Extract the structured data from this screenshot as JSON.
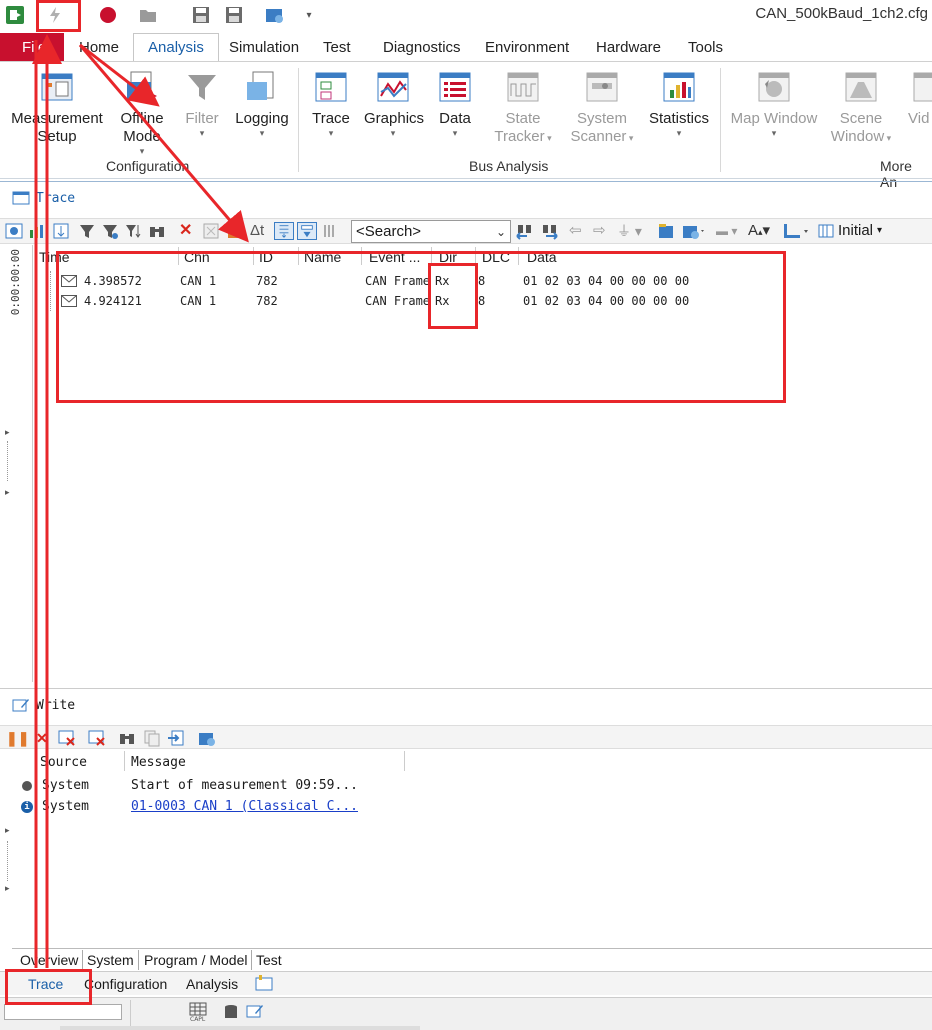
{
  "window": {
    "title": "CAN_500kBaud_1ch2.cfg"
  },
  "menu": {
    "file": "File",
    "tabs": [
      "Home",
      "Analysis",
      "Simulation",
      "Test",
      "Diagnostics",
      "Environment",
      "Hardware",
      "Tools"
    ],
    "active": "Analysis"
  },
  "ribbon": {
    "groups": {
      "configuration": "Configuration",
      "bus_analysis": "Bus Analysis",
      "more": "More An"
    },
    "buttons": {
      "measurement_setup": [
        "Measurement",
        "Setup"
      ],
      "offline_mode": [
        "Offline",
        "Mode"
      ],
      "filter": "Filter",
      "logging": "Logging",
      "trace": "Trace",
      "graphics": "Graphics",
      "data": "Data",
      "state_tracker": [
        "State",
        "Tracker"
      ],
      "system_scanner": [
        "System",
        "Scanner"
      ],
      "statistics": "Statistics",
      "map_window": "Map Window",
      "scene_window": [
        "Scene",
        "Window"
      ],
      "video": "Vid"
    }
  },
  "trace": {
    "title": "Trace",
    "search_placeholder": "<Search>",
    "initial_label": "Initial",
    "vertical_time": "0:00:00:00",
    "columns": [
      "Time",
      "Chn",
      "ID",
      "Name",
      "Event ...",
      "Dir",
      "DLC",
      "Data"
    ],
    "rows": [
      {
        "time": "4.398572",
        "chn": "CAN 1",
        "id": "782",
        "name": "",
        "event": "CAN Frame",
        "dir": "Rx",
        "dlc": "8",
        "data": "01 02 03 04 00 00 00 00"
      },
      {
        "time": "4.924121",
        "chn": "CAN 1",
        "id": "782",
        "name": "",
        "event": "CAN Frame",
        "dir": "Rx",
        "dlc": "8",
        "data": "01 02 03 04 00 00 00 00"
      }
    ]
  },
  "write": {
    "title": "Write",
    "columns": [
      "Source",
      "Message"
    ],
    "rows": [
      {
        "source": "System",
        "message": "Start of measurement 09:59..."
      },
      {
        "source": "System",
        "message": "01-0003 CAN 1 (Classical C..."
      }
    ]
  },
  "bottom_tabs": [
    "Overview",
    "System",
    "Program / Model",
    "Test"
  ],
  "window_tabs": [
    "Trace",
    "Configuration",
    "Analysis"
  ],
  "colors": {
    "accent": "#1a5fa8",
    "file_tab": "#c8102e",
    "annotation": "#e8262a"
  }
}
